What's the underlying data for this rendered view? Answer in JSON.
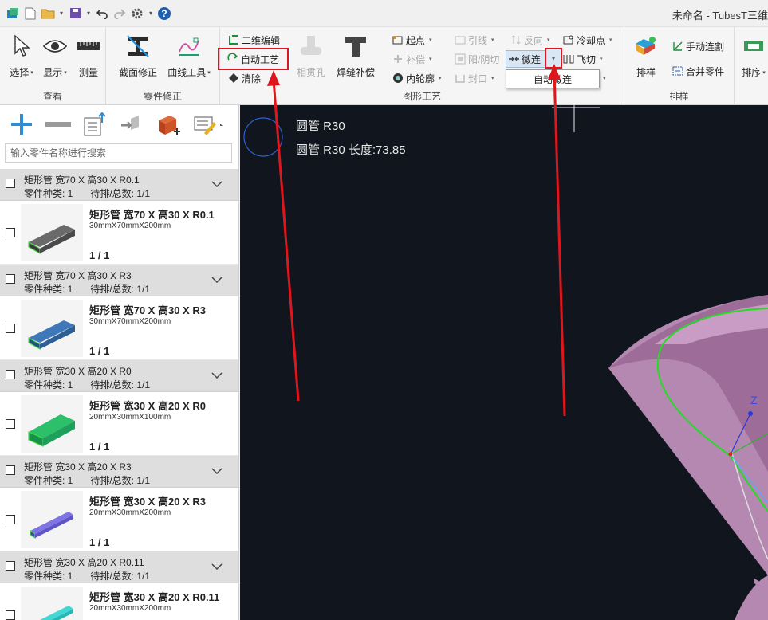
{
  "window": {
    "title": "未命名 - TubesT三维"
  },
  "ribbon": {
    "view_group": {
      "label": "查看",
      "select": "选择",
      "display": "显示",
      "measure": "测量"
    },
    "part_fix_group": {
      "label": "零件修正",
      "section_fix": "截面修正",
      "curve_tools": "曲线工具"
    },
    "graphic_process_group": {
      "label": "图形工艺",
      "edit_2d": "二维编辑",
      "auto_process": "自动工艺",
      "clear": "清除",
      "intersect_hole": "相贯孔",
      "weld_compensation": "焊缝补偿",
      "start_point": "起点",
      "lead_line": "引线",
      "reverse": "反向",
      "cooling_point": "冷却点",
      "compensation": "补偿",
      "yin_yang_cut": "阳/阴切",
      "micro_joint": "微连",
      "fly_cut": "飞切",
      "inner_contour": "内轮廓",
      "seal": "封口"
    },
    "nesting_group": {
      "label": "排样",
      "nesting": "排样",
      "manual_cut": "手动连割",
      "merge_parts": "合并零件"
    },
    "sort_group": {
      "sort": "排序"
    }
  },
  "dropdown": {
    "auto_micro_joint": "自动微连"
  },
  "parts_panel": {
    "search_placeholder": "输入零件名称进行搜索",
    "groups": [
      {
        "title": "矩形管 宽70 X 高30 X R0.1",
        "kinds": "零件种类: 1",
        "pending": "待排/总数: 1/1",
        "item": {
          "name": "矩形管 宽70 X 高30 X R0.1",
          "dims": "30mmX70mmX200mm",
          "count": "1 / 1"
        }
      },
      {
        "title": "矩形管 宽70 X 高30 X R3",
        "kinds": "零件种类: 1",
        "pending": "待排/总数: 1/1",
        "item": {
          "name": "矩形管 宽70 X 高30 X R3",
          "dims": "30mmX70mmX200mm",
          "count": "1 / 1"
        }
      },
      {
        "title": "矩形管 宽30 X 高20 X R0",
        "kinds": "零件种类: 1",
        "pending": "待排/总数: 1/1",
        "item": {
          "name": "矩形管 宽30 X 高20 X R0",
          "dims": "20mmX30mmX100mm",
          "count": "1 / 1"
        }
      },
      {
        "title": "矩形管 宽30 X 高20 X R3",
        "kinds": "零件种类: 1",
        "pending": "待排/总数: 1/1",
        "item": {
          "name": "矩形管 宽30 X 高20 X R3",
          "dims": "20mmX30mmX200mm",
          "count": "1 / 1"
        }
      },
      {
        "title": "矩形管 宽30 X 高20 X R0.11",
        "kinds": "零件种类: 1",
        "pending": "待排/总数: 1/1",
        "item": {
          "name": "矩形管 宽30 X 高20 X R0.11",
          "dims": "20mmX30mmX200mm",
          "count": ""
        }
      }
    ]
  },
  "canvas": {
    "tube_label": "圆管 R30",
    "tube_length": "圆管 R30 长度:73.85",
    "axis_z": "Z"
  },
  "colors": {
    "highlight": "#e0161e",
    "canvas_bg": "#11161e",
    "part_colors": [
      "#555555",
      "#2f5f9a",
      "#1fa05a",
      "#6a5ad0",
      "#27c2c0"
    ]
  }
}
